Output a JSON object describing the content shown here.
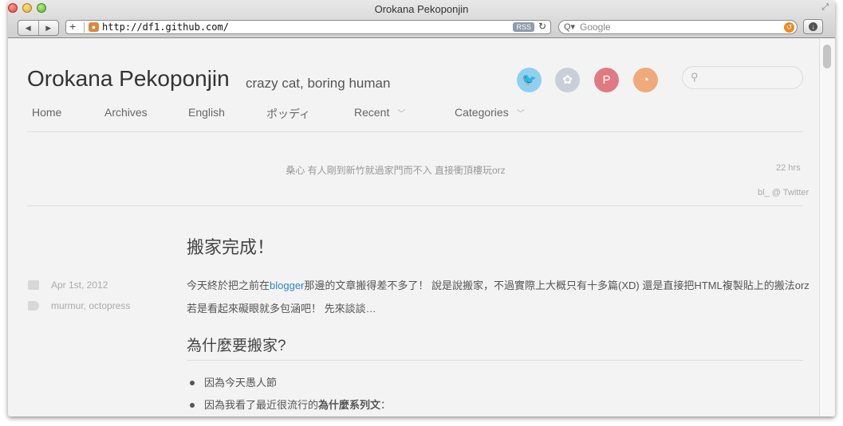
{
  "browser": {
    "window_title": "Orokana Pekoponjin",
    "url": "http://df1.github.com/",
    "rss_label": "RSS",
    "search_placeholder": "Google"
  },
  "site": {
    "title": "Orokana Pekoponjin",
    "subtitle": "crazy cat, boring human",
    "social": [
      {
        "icon": "twitter-icon",
        "glyph": "🐦",
        "color": "#8fd0f0"
      },
      {
        "icon": "github-icon",
        "glyph": "✿",
        "color": "#c8cfd9"
      },
      {
        "icon": "pinterest-icon",
        "glyph": "P",
        "color": "#e07a82"
      },
      {
        "icon": "rss-icon",
        "glyph": "◔",
        "color": "#eeaa7a"
      }
    ],
    "nav": [
      "Home",
      "Archives",
      "English",
      "ポッディ",
      "Recent",
      "Categories"
    ]
  },
  "tweet": {
    "text": "桑心 有人剛到新竹就過家門而不入 直接衝頂樓玩orz",
    "time": "22 hrs",
    "source": "bl_ @ Twitter"
  },
  "post": {
    "title": "搬家完成！",
    "date": "Apr 1st, 2012",
    "tags": "murmur, octopress",
    "para_before_link": "今天終於把之前在",
    "link_text": "blogger",
    "para_after_link": "那邊的文章搬得差不多了！ 說是說搬家，不過實際上大概只有十多篇(XD) 還是直接把HTML複製貼上的搬法orz 若是看起來礙眼就多包涵吧！ 先來談談…",
    "heading": "為什麼要搬家?",
    "list_item_1": "因為今天愚人節",
    "list_item_2_prefix": "因為我看了最近很流行的",
    "list_item_2_bold": "為什麼系列文",
    "list_item_2_suffix": "："
  }
}
